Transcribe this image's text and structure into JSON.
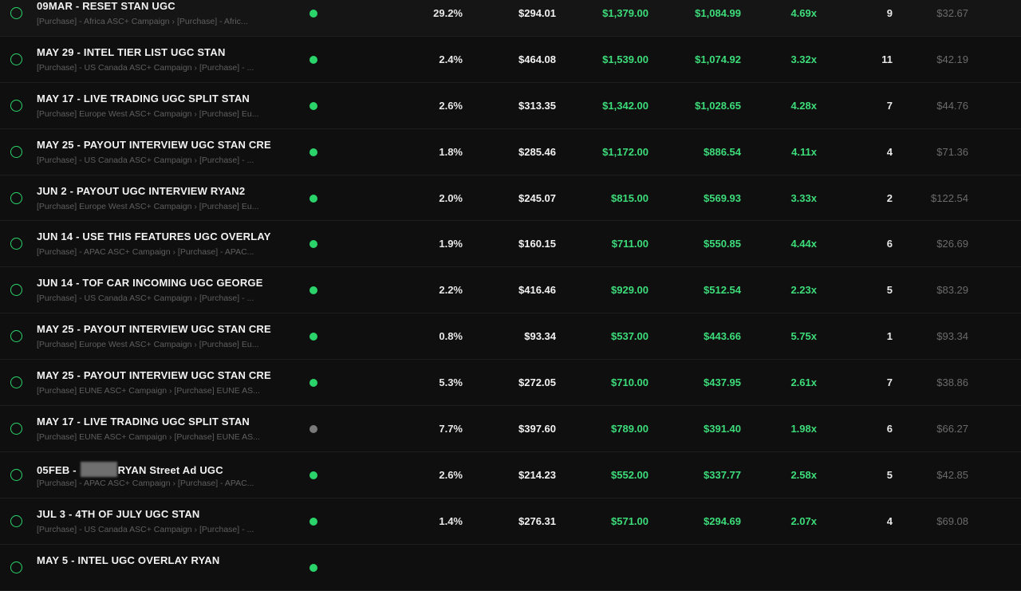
{
  "colors": {
    "accent": "#2bd46a",
    "positive": "#3ddc7a",
    "muted": "#6b6b6b",
    "inactive": "#7a7a7a"
  },
  "icons": {
    "row_check": "circle-check-icon",
    "status": "status-dot-icon",
    "redaction": "redacted-block"
  },
  "rows": [
    {
      "name": "09MAR - RESET STAN UGC",
      "sub": "[Purchase] - Africa ASC+ Campaign › [Purchase] - Afric...",
      "active": true,
      "pct": "29.2%",
      "spend": "$294.01",
      "revenue": "$1,379.00",
      "profit": "$1,084.99",
      "roas": "4.69x",
      "count": "9",
      "cpa": "$32.67"
    },
    {
      "name": "MAY 29 - INTEL TIER LIST UGC STAN",
      "sub": "[Purchase] - US Canada ASC+ Campaign › [Purchase] - ...",
      "active": true,
      "pct": "2.4%",
      "spend": "$464.08",
      "revenue": "$1,539.00",
      "profit": "$1,074.92",
      "roas": "3.32x",
      "count": "11",
      "cpa": "$42.19"
    },
    {
      "name": "MAY 17 - LIVE TRADING UGC SPLIT STAN",
      "sub": "[Purchase] Europe West ASC+ Campaign › [Purchase] Eu...",
      "active": true,
      "pct": "2.6%",
      "spend": "$313.35",
      "revenue": "$1,342.00",
      "profit": "$1,028.65",
      "roas": "4.28x",
      "count": "7",
      "cpa": "$44.76"
    },
    {
      "name": "MAY 25 - PAYOUT INTERVIEW UGC STAN CRE",
      "sub": "[Purchase] - US Canada ASC+ Campaign › [Purchase] - ...",
      "active": true,
      "pct": "1.8%",
      "spend": "$285.46",
      "revenue": "$1,172.00",
      "profit": "$886.54",
      "roas": "4.11x",
      "count": "4",
      "cpa": "$71.36"
    },
    {
      "name": "JUN 2 - PAYOUT UGC INTERVIEW RYAN2",
      "sub": "[Purchase] Europe West ASC+ Campaign › [Purchase] Eu...",
      "active": true,
      "pct": "2.0%",
      "spend": "$245.07",
      "revenue": "$815.00",
      "profit": "$569.93",
      "roas": "3.33x",
      "count": "2",
      "cpa": "$122.54"
    },
    {
      "name": "JUN 14 - USE THIS FEATURES UGC OVERLAY",
      "sub": "[Purchase] - APAC ASC+ Campaign › [Purchase] - APAC...",
      "active": true,
      "pct": "1.9%",
      "spend": "$160.15",
      "revenue": "$711.00",
      "profit": "$550.85",
      "roas": "4.44x",
      "count": "6",
      "cpa": "$26.69"
    },
    {
      "name": "JUN 14 - TOF CAR INCOMING UGC GEORGE",
      "sub": "[Purchase] - US Canada ASC+ Campaign › [Purchase] - ...",
      "active": true,
      "pct": "2.2%",
      "spend": "$416.46",
      "revenue": "$929.00",
      "profit": "$512.54",
      "roas": "2.23x",
      "count": "5",
      "cpa": "$83.29"
    },
    {
      "name": "MAY 25 - PAYOUT INTERVIEW UGC STAN CRE",
      "sub": "[Purchase] Europe West ASC+ Campaign › [Purchase] Eu...",
      "active": true,
      "pct": "0.8%",
      "spend": "$93.34",
      "revenue": "$537.00",
      "profit": "$443.66",
      "roas": "5.75x",
      "count": "1",
      "cpa": "$93.34"
    },
    {
      "name": "MAY 25 - PAYOUT INTERVIEW UGC STAN CRE",
      "sub": "[Purchase] EUNE ASC+ Campaign › [Purchase] EUNE AS...",
      "active": true,
      "pct": "5.3%",
      "spend": "$272.05",
      "revenue": "$710.00",
      "profit": "$437.95",
      "roas": "2.61x",
      "count": "7",
      "cpa": "$38.86"
    },
    {
      "name": "MAY 17 - LIVE TRADING UGC SPLIT STAN",
      "sub": "[Purchase] EUNE ASC+ Campaign › [Purchase] EUNE AS...",
      "active": false,
      "pct": "7.7%",
      "spend": "$397.60",
      "revenue": "$789.00",
      "profit": "$391.40",
      "roas": "1.98x",
      "count": "6",
      "cpa": "$66.27"
    },
    {
      "name_before": "05FEB -",
      "name_after": "RYAN Street Ad UGC",
      "redacted": true,
      "sub": "[Purchase] - APAC ASC+ Campaign › [Purchase] - APAC...",
      "active": true,
      "pct": "2.6%",
      "spend": "$214.23",
      "revenue": "$552.00",
      "profit": "$337.77",
      "roas": "2.58x",
      "count": "5",
      "cpa": "$42.85"
    },
    {
      "name": "JUL 3 - 4TH OF JULY UGC STAN",
      "sub": "[Purchase] - US Canada ASC+ Campaign › [Purchase] - ...",
      "active": true,
      "pct": "1.4%",
      "spend": "$276.31",
      "revenue": "$571.00",
      "profit": "$294.69",
      "roas": "2.07x",
      "count": "4",
      "cpa": "$69.08"
    },
    {
      "name": "MAY 5 - INTEL UGC OVERLAY RYAN",
      "sub": "",
      "active": true,
      "pct": "",
      "spend": "",
      "revenue": "",
      "profit": "",
      "roas": "",
      "count": "",
      "cpa": ""
    }
  ]
}
